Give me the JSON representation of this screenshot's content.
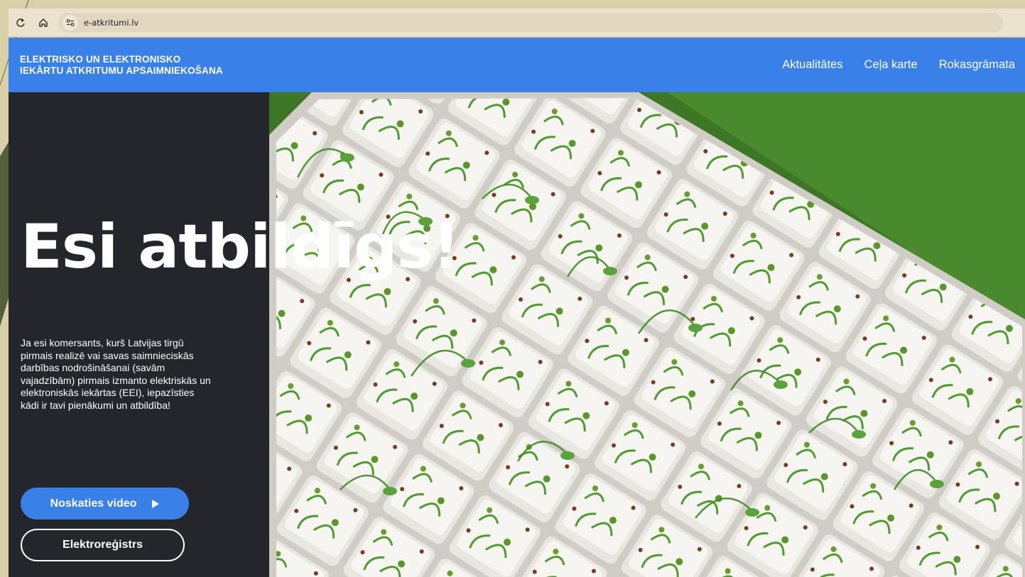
{
  "browser": {
    "url": "e-atkritumi.lv"
  },
  "header": {
    "brand_line1": "ELEKTRISKO UN ELEKTRONISKO",
    "brand_line2": "IEKĀRTU ATKRITUMU APSAIMNIEKOŠANA",
    "nav": [
      "Aktualitātes",
      "Ceļa karte",
      "Rokasgrāmata"
    ]
  },
  "hero": {
    "title": "Esi  atbildīgs!",
    "description": "Ja esi komersants, kurš Latvijas tirgū pirmais realizē vai savas saimnieciskās darbības nodrošināšanai (savām vajadzībām) pirmais izmanto elektriskās un elektroniskās iekārtas (EEI), iepazīsties kādi ir tavi pienākumi un atbildība!",
    "video_button": "Noskaties video",
    "register_button": "Elektroreģistrs"
  },
  "colors": {
    "accent": "#3980e8",
    "dark_panel": "#24262b"
  }
}
